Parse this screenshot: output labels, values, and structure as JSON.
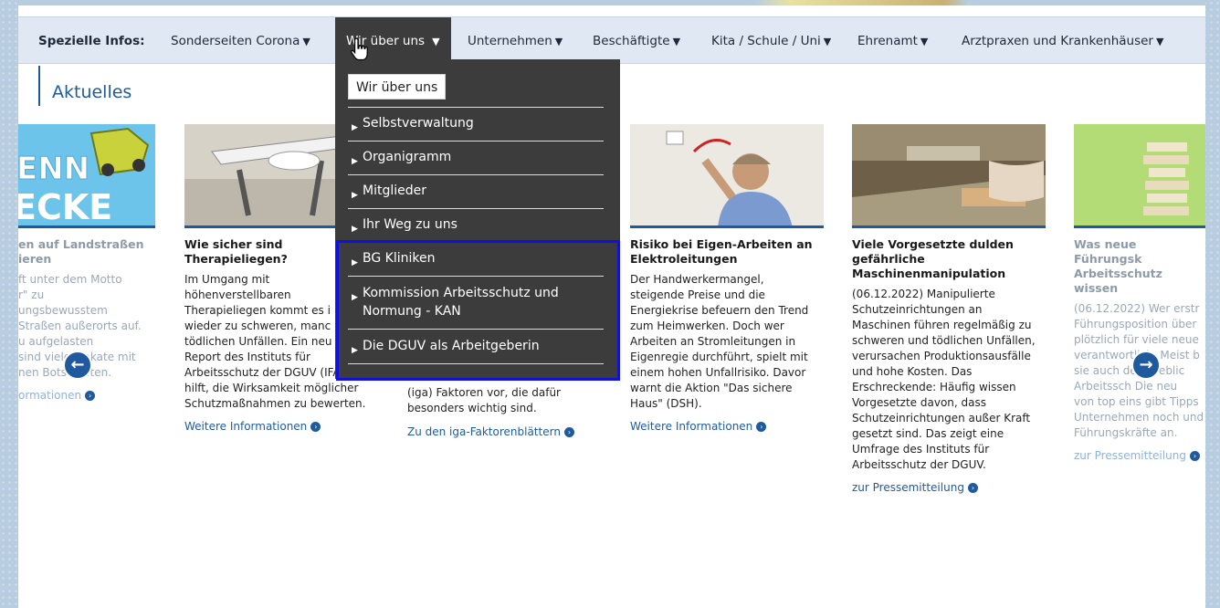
{
  "nav": {
    "label": "Spezielle Infos:",
    "items": [
      {
        "label": "Sonderseiten Corona",
        "caret": "▼"
      },
      {
        "label": "Wir über uns",
        "caret": "▼"
      },
      {
        "label": "Unternehmen",
        "caret": "▼"
      },
      {
        "label": "Beschäftigte",
        "caret": "▼"
      },
      {
        "label": "Kita / Schule / Uni",
        "caret": "▼"
      },
      {
        "label": "Ehrenamt",
        "caret": "▼"
      },
      {
        "label": "Arztpraxen und Krankenhäuser",
        "caret": "▼"
      }
    ]
  },
  "section_title": "Aktuelles",
  "dropdown": {
    "header": "Wir über uns",
    "items": [
      "Selbstverwaltung",
      "Organigramm",
      "Mitglieder",
      "Ihr Weg zu uns",
      "BG Kliniken",
      "Kommission Arbeitsschutz und Normung - KAN",
      "Die DGUV als Arbeitgeberin"
    ]
  },
  "cards": [
    {
      "title": "en auf Landstraßen\nieren",
      "text": "ft unter dem Motto\nr\" zu\nungsbewusstem\nStraßen außerorts auf.\nu aufgelasten\nsind viele Plakate mit\nnen Botschaften.",
      "link": "ormationen",
      "img_text": "ENN\nECKE"
    },
    {
      "title": "Wie sicher sind\nTherapieliegen?",
      "text": "Im Umgang mit\nhöhenverstellbaren\nTherapieliegen kommt es i\nwieder zu schweren, manc\ntödlichen Unfällen. Ein neu\nReport des Instituts für\nArbeitsschutz der DGUV (IFA)\nhilft, die Wirksamkeit möglicher\nSchutzmaßnahmen zu bewerten.",
      "link": "Weitere Informationen"
    },
    {
      "title": "",
      "text": "(iga) Faktoren vor, die dafür\nbesonders wichtig sind.",
      "link": "Zu den iga-Faktorenblättern"
    },
    {
      "title": "Risiko bei Eigen-Arbeiten an\nElektroleitungen",
      "text": "Der Handwerkermangel,\nsteigende Preise und die\nEnergiekrise befeuern den Trend\nzum Heimwerken. Doch wer\nArbeiten an Stromleitungen in\nEigenregie durchführt, spielt mit\neinem hohen Unfallrisiko. Davor\nwarnt die Aktion \"Das sichere\nHaus\" (DSH).",
      "link": "Weitere Informationen"
    },
    {
      "title": "Viele Vorgesetzte dulden\ngefährliche\nMaschinenmanipulation",
      "text": "(06.12.2022) Manipulierte\nSchutzeinrichtungen an\nMaschinen führen regelmäßig zu\nschweren und tödlichen Unfällen,\nverursachen Produktionsausfälle\nund hohe Kosten. Das\nErschreckende: Häufig wissen\nVorgesetzte davon, dass\nSchutzeinrichtungen außer Kraft\ngesetzt sind. Das zeigt eine\nUmfrage des Instituts für\nArbeitsschutz der DGUV.",
      "link": "zur Pressemitteilung"
    },
    {
      "title": "Was neue Führungsk\nArbeitsschutz wissen",
      "text": "(06.12.2022) Wer erstr\nFührungsposition über\nplötzlich für viele neue\nverantwortlich. Meist b\nsie auch de  etrieblic\nArbeitssch  Die neu\nvon top eins gibt Tipps\nUnternehmen noch und\nFührungskräfte an.",
      "link": "zur Pressemitteilung"
    }
  ],
  "icons": {
    "prev": "arrow-left-circle",
    "next": "arrow-right-circle",
    "cursor": "hand-pointer"
  },
  "colors": {
    "accent": "#1f5a9e",
    "nav_bg": "#dfe8f3",
    "dropdown_bg": "#3c3c3c",
    "highlight": "#1010e0"
  }
}
